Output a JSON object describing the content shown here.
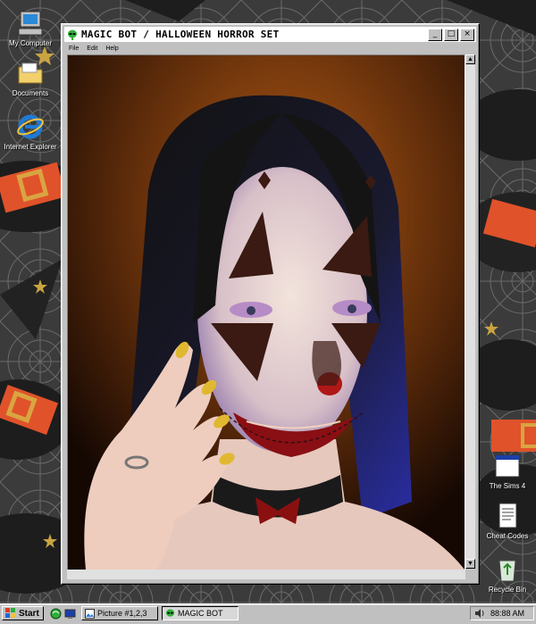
{
  "desktop": {
    "icons": [
      {
        "label": "My Computer",
        "icon": "my-computer-icon"
      },
      {
        "label": "Documents",
        "icon": "folder-icon"
      },
      {
        "label": "Internet Explorer",
        "icon": "internet-explorer-icon"
      },
      {
        "label": "The Sims 4",
        "icon": "application-window-icon"
      },
      {
        "label": "Cheat Codes",
        "icon": "text-document-icon"
      },
      {
        "label": "Recycle Bin",
        "icon": "recycle-bin-icon"
      }
    ]
  },
  "window": {
    "title": "MAGIC BOT / HALLOWEEN HORROR SET",
    "menu": [
      "File",
      "Edit",
      "Help"
    ],
    "controls": {
      "minimize": "_",
      "maximize": "□",
      "close": "×"
    },
    "content": "portrait of a woman with black hair in clown face paint, purple eyeshadow and yellow nails"
  },
  "taskbar": {
    "start_label": "Start",
    "quicklaunch": [
      "browser-icon",
      "desktop-icon"
    ],
    "tasks": [
      {
        "label": "Picture #1,2,3",
        "icon": "image-icon"
      },
      {
        "label": "MAGIC BOT",
        "icon": "alien-icon"
      }
    ],
    "tray": {
      "time": "88:88 AM",
      "icon": "volume-icon"
    }
  },
  "colors": {
    "window_chrome": "#c0c0c0",
    "titlebar": "#ffffff",
    "wallpaper": "#3a3a3a",
    "hat_band": "#e0522a",
    "buckle": "#d9a441"
  }
}
